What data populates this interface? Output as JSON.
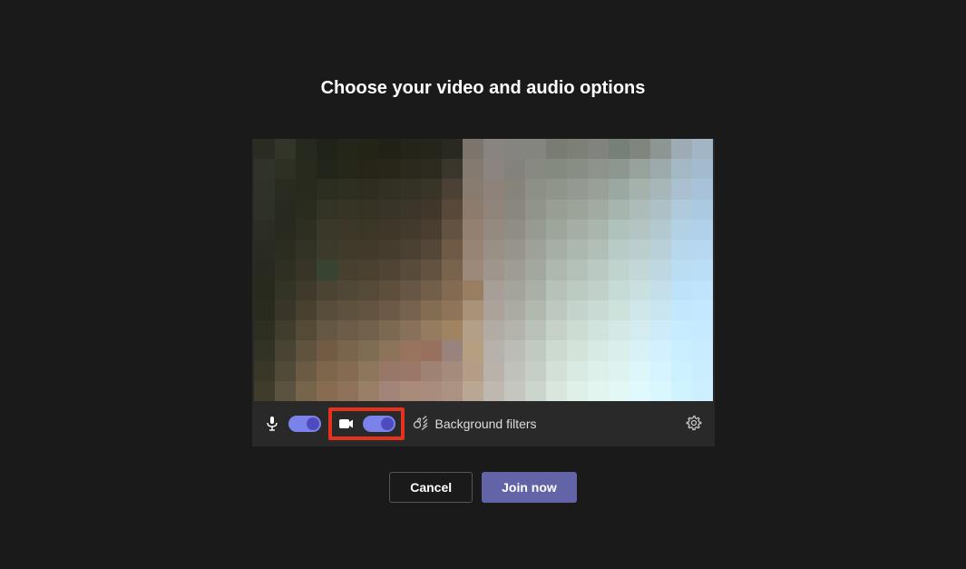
{
  "title": "Choose your video and audio options",
  "controls": {
    "mic_on": true,
    "camera_on": true,
    "background_filters_label": "Background filters"
  },
  "actions": {
    "cancel_label": "Cancel",
    "join_label": "Join now"
  },
  "preview_pixels": [
    [
      "#2a2b23",
      "#343529",
      "#262a1e",
      "#1f2318",
      "#232619",
      "#232316",
      "#222116",
      "#25241a",
      "#26251b",
      "#2a2920",
      "#7b756d",
      "#8a8480",
      "#858481",
      "#84857e",
      "#787c72",
      "#7d8077",
      "#81847e",
      "#778078",
      "#80867e",
      "#8e9693",
      "#9dabb4",
      "#a2b5c4"
    ],
    [
      "#30332a",
      "#2e3024",
      "#282a1e",
      "#22251a",
      "#24271a",
      "#262518",
      "#282619",
      "#2b291d",
      "#2d2b20",
      "#3a362d",
      "#847a70",
      "#8c857f",
      "#84827c",
      "#888a81",
      "#858a7f",
      "#898e85",
      "#8e938c",
      "#8c9790",
      "#98a29d",
      "#9daaac",
      "#a4b7c5",
      "#a3bbcf"
    ],
    [
      "#2f3228",
      "#2a2c21",
      "#292a1e",
      "#2c2e21",
      "#2e2e21",
      "#2e2d1f",
      "#323023",
      "#353225",
      "#393428",
      "#4b4134",
      "#887b6f",
      "#8d837b",
      "#86837b",
      "#8d9087",
      "#8f958a",
      "#949a91",
      "#99a098",
      "#9aa8a1",
      "#a5b1ad",
      "#a6b6b9",
      "#aac0d1",
      "#a7c2d9"
    ],
    [
      "#2e3126",
      "#282a1f",
      "#2a2c1f",
      "#333426",
      "#363425",
      "#363224",
      "#383427",
      "#3b3629",
      "#41382b",
      "#574839",
      "#8d7c6d",
      "#91857b",
      "#8a877e",
      "#91948a",
      "#989e93",
      "#9ca49a",
      "#a2aba2",
      "#a6b6af",
      "#adbbb9",
      "#adc0c5",
      "#aecadb",
      "#acc9e2"
    ],
    [
      "#2c2e23",
      "#282a1f",
      "#2e2f22",
      "#393829",
      "#3c3728",
      "#3c3627",
      "#3e372a",
      "#423a2c",
      "#4a3e30",
      "#645240",
      "#938070",
      "#958a7f",
      "#908e84",
      "#969a90",
      "#9ea69c",
      "#a4aea5",
      "#aab5ac",
      "#b0c2bc",
      "#b4c4c3",
      "#b3c9d0",
      "#b2d1e4",
      "#b1d0ea"
    ],
    [
      "#2a2c21",
      "#2b2d21",
      "#323225",
      "#3c3a2b",
      "#403a2a",
      "#413a2b",
      "#453c2e",
      "#4b4132",
      "#554737",
      "#6f5a46",
      "#988474",
      "#9a8f85",
      "#97948b",
      "#9da197",
      "#a6afa5",
      "#acb8af",
      "#b2bfb6",
      "#b9cbc6",
      "#bbcdcc",
      "#b9d0d8",
      "#b7d7ec",
      "#b7d7f1"
    ],
    [
      "#282a1f",
      "#2f2f23",
      "#383528",
      "#394331",
      "#473f2f",
      "#4a4131",
      "#504535",
      "#584b3a",
      "#63523f",
      "#79634d",
      "#9c897a",
      "#9f958c",
      "#9e9c93",
      "#a3a89e",
      "#aeb8ae",
      "#b4c1b8",
      "#bac9c1",
      "#c1d3cd",
      "#c3d7d7",
      "#bed8e2",
      "#baddf3",
      "#bbdef7"
    ],
    [
      "#282a1e",
      "#333326",
      "#3f3a2b",
      "#4b4433",
      "#514736",
      "#554938",
      "#5d4f3c",
      "#675643",
      "#735e49",
      "#836b53",
      "#997e62",
      "#a79f97",
      "#a5a49c",
      "#aab0a6",
      "#b6c1b7",
      "#bccac1",
      "#c1d1ca",
      "#c7dbd6",
      "#c9dfe0",
      "#c4deea",
      "#bee2f9",
      "#bfe4fc"
    ],
    [
      "#2a2b1f",
      "#393629",
      "#49412f",
      "#584d3a",
      "#5e513d",
      "#625441",
      "#6c5a46",
      "#77634d",
      "#846c53",
      "#8f745a",
      "#a89379",
      "#aba29a",
      "#acaba3",
      "#b1b8ae",
      "#bdc9c0",
      "#c4d3cb",
      "#c8dad3",
      "#cee2dc",
      "#cfe6ea",
      "#c9e5f0",
      "#c3e7fd",
      "#c3e8ff"
    ],
    [
      "#2e2e21",
      "#403d2e",
      "#544a36",
      "#655843",
      "#6d5d48",
      "#72624d",
      "#7d6852",
      "#88715a",
      "#957b60",
      "#a08361",
      "#b39e88",
      "#b2aba3",
      "#b4b4ad",
      "#bac1b8",
      "#c6d2c8",
      "#ccdcd3",
      "#d0e3dc",
      "#d4e9e5",
      "#d4ecf0",
      "#cdebf8",
      "#c7ecff",
      "#c6eaff"
    ],
    [
      "#333325",
      "#484332",
      "#5f533e",
      "#725b44",
      "#79644d",
      "#7f6c55",
      "#8c745b",
      "#98735d",
      "#97705e",
      "#9b837d",
      "#b69e81",
      "#b7b1ab",
      "#babcb5",
      "#c1c9c0",
      "#cddad0",
      "#d3e3da",
      "#d7eae3",
      "#daefec",
      "#d8f1f6",
      "#d2f0fd",
      "#caefff",
      "#c9ecff"
    ],
    [
      "#393728",
      "#524a38",
      "#6b5b44",
      "#7e664c",
      "#856b51",
      "#8c765c",
      "#987668",
      "#9b7768",
      "#9e8274",
      "#a48b7c",
      "#b49d86",
      "#b9b2aa",
      "#bfc1ba",
      "#c7cec5",
      "#d3e0d7",
      "#d9eae2",
      "#ddf0e9",
      "#def3f0",
      "#dcf6fa",
      "#d5f4ff",
      "#ccf1ff",
      "#cbeeff"
    ],
    [
      "#3f3c2c",
      "#5b5240",
      "#76644b",
      "#886c51",
      "#90725a",
      "#987f65",
      "#a38479",
      "#aa8a79",
      "#a98c7c",
      "#ac9281",
      "#b9a693",
      "#beb8b0",
      "#c4c6bf",
      "#ccd5cc",
      "#d8e6dd",
      "#def0e8",
      "#e2f5ef",
      "#e3f7f5",
      "#dff9fe",
      "#d8f7ff",
      "#cff3ff",
      "#cdefff"
    ]
  ]
}
